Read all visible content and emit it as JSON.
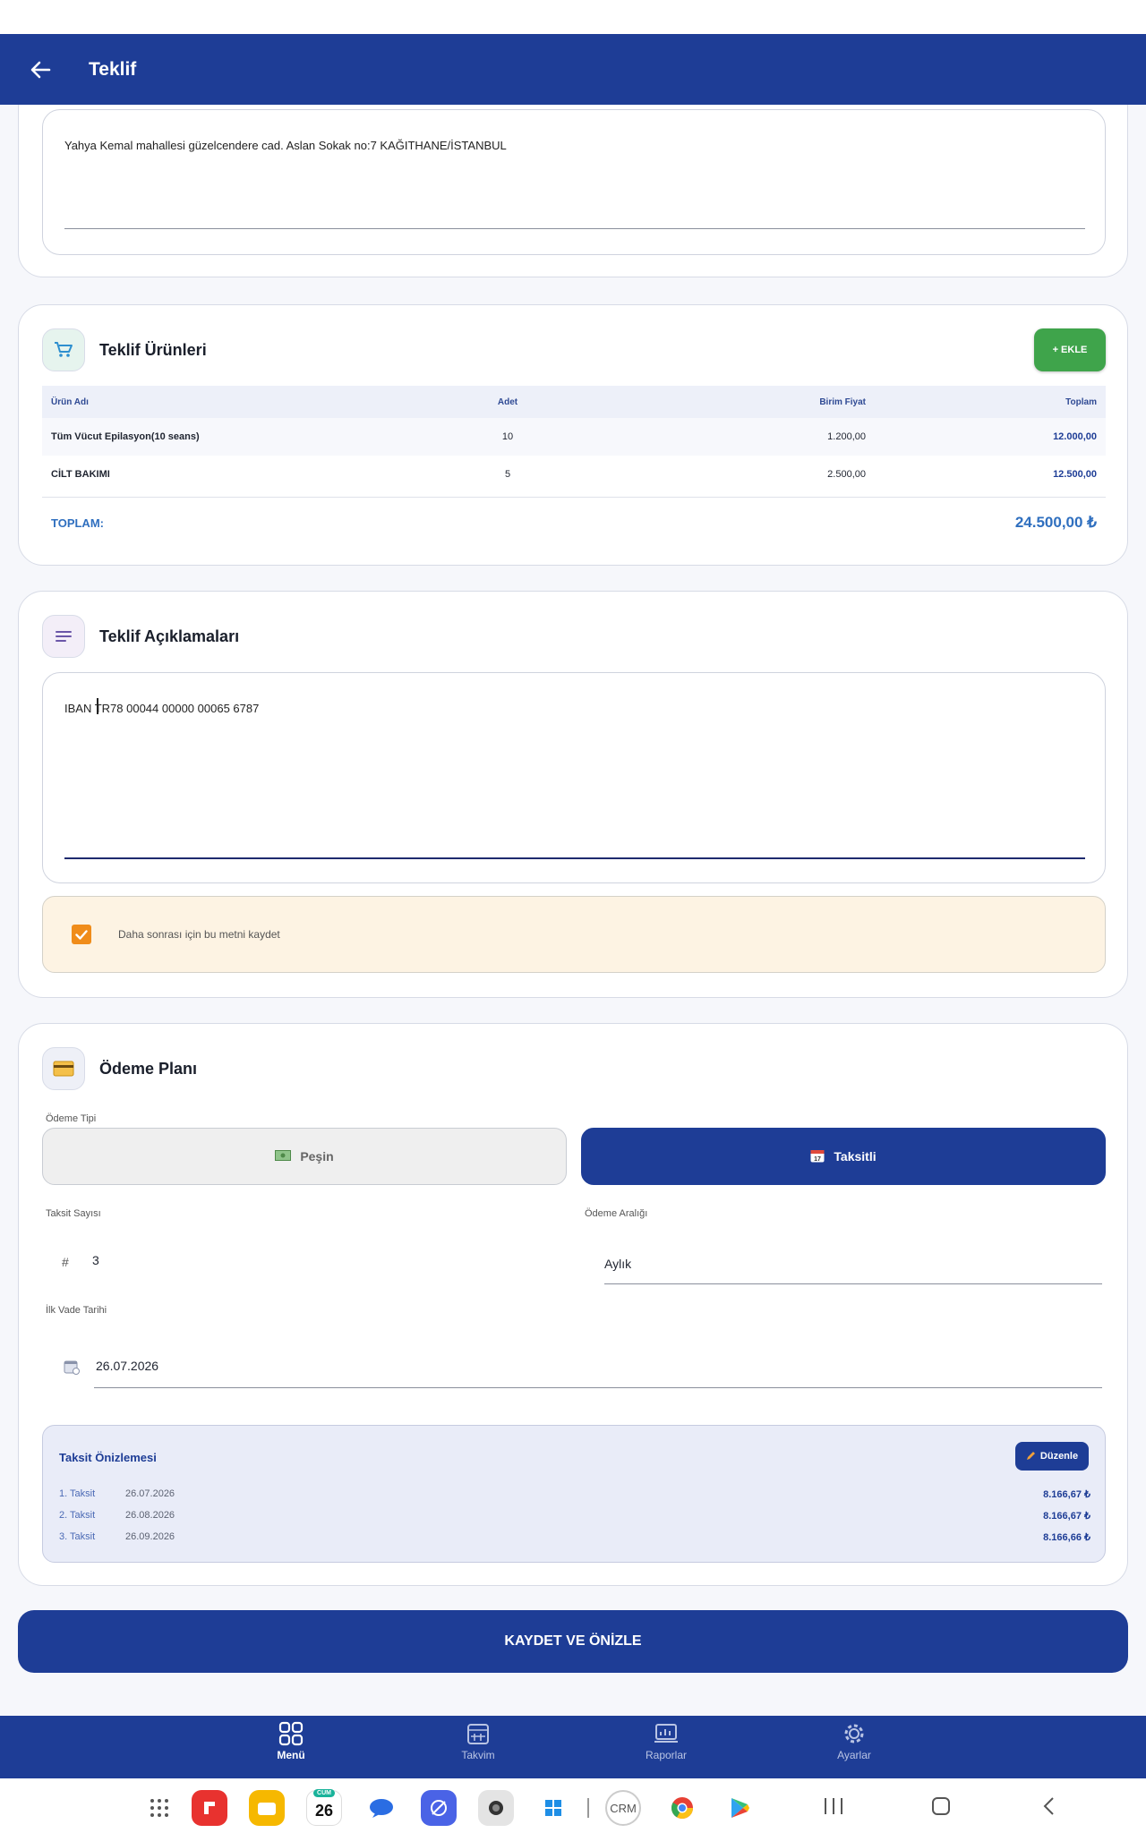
{
  "app_bar": {
    "title": "Teklif"
  },
  "address": {
    "text": "Yahya Kemal mahallesi güzelcendere cad. Aslan Sokak no:7 KAĞITHANE/İSTANBUL"
  },
  "products": {
    "title": "Teklif Ürünleri",
    "add_label": "+ EKLE",
    "columns": [
      "Ürün Adı",
      "Adet",
      "Birim Fiyat",
      "Toplam"
    ],
    "rows": [
      [
        "Tüm Vücut Epilasyon(10 seans)",
        "10",
        "1.200,00",
        "12.000,00"
      ],
      [
        "CİLT BAKIMI",
        "5",
        "2.500,00",
        "12.500,00"
      ]
    ],
    "total_label": "TOPLAM:",
    "total_value": "24.500,00 ₺"
  },
  "notes": {
    "title": "Teklif Açıklamaları",
    "text": "IBAN  TR78 00044 00000 00065 6787",
    "save_label": "Daha sonrası için bu metni kaydet",
    "save_checked": true
  },
  "payment": {
    "title": "Ödeme Planı",
    "type_label": "Ödeme Tipi",
    "cash_label": "Peşin",
    "installment_label": "Taksitli",
    "selected": "Taksitli",
    "count_label": "Taksit Sayısı",
    "count_prefix": "#",
    "count_value": "3",
    "interval_label": "Ödeme Aralığı",
    "interval_value": "Aylık",
    "first_due_label": "İlk Vade Tarihi",
    "first_due_value": "26.07.2026",
    "preview": {
      "title": "Taksit Önizlemesi",
      "edit_label": "Düzenle",
      "items": [
        {
          "name": "1. Taksit",
          "date": "26.07.2026",
          "amount": "8.166,67 ₺"
        },
        {
          "name": "2. Taksit",
          "date": "26.08.2026",
          "amount": "8.166,67 ₺"
        },
        {
          "name": "3. Taksit",
          "date": "26.09.2026",
          "amount": "8.166,66 ₺"
        }
      ]
    }
  },
  "primary_action": "KAYDET VE ÖNİZLE",
  "bottom_nav": [
    {
      "label": "Menü",
      "icon": "grid-icon",
      "active": true
    },
    {
      "label": "Takvim",
      "icon": "calendar-icon",
      "active": false
    },
    {
      "label": "Raporlar",
      "icon": "report-icon",
      "active": false
    },
    {
      "label": "Ayarlar",
      "icon": "gear-icon",
      "active": false
    }
  ],
  "dock": {
    "calendar_day": "26",
    "calendar_weekday": "CUM",
    "crm_label": "CRM"
  },
  "colors": {
    "primary": "#1e3d96",
    "accent_green": "#3fa44b",
    "accent_orange": "#f08c1a",
    "total_blue": "#2f6fbf"
  }
}
